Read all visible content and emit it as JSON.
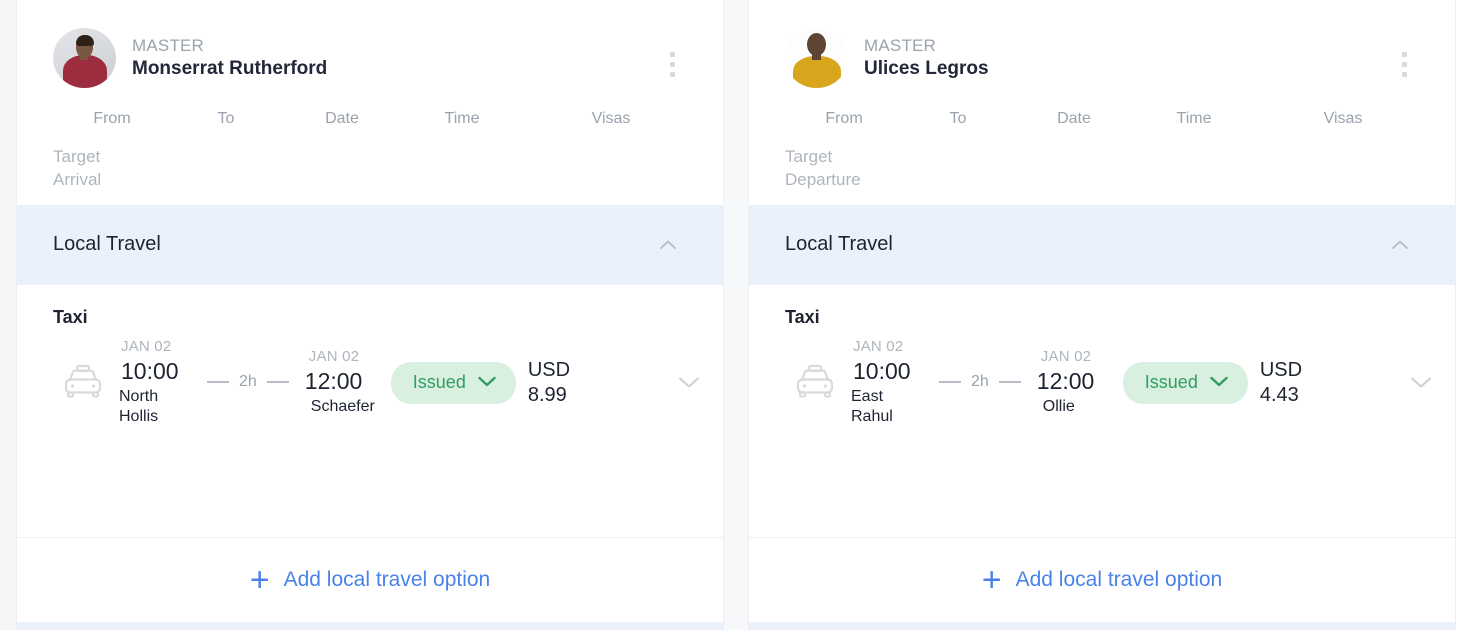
{
  "columns": [
    "From",
    "To",
    "Date",
    "Time",
    "Visas"
  ],
  "section": {
    "title": "Local Travel",
    "collapse_icon": "chevron-up-icon"
  },
  "footer": {
    "plus": "+",
    "label": "Add local travel option"
  },
  "colors": {
    "link": "#4a82e8",
    "badge_bg": "#d9f0e1",
    "badge_text": "#2f9e60",
    "section_bg": "#eaf1fb",
    "card_bg": "#ffffff",
    "page_bg": "#f4f5f7",
    "muted": "#9aa3ad",
    "text": "#1d2330"
  },
  "cards": [
    {
      "role": "MASTER",
      "name": "Monserrat Rutherford",
      "avatar": "person-photo-maroon-shirt",
      "menu_icon": "kebab-menu-icon",
      "target_label": "Target\nArrival",
      "target_line1": "Target",
      "target_line2": "Arrival",
      "segment": {
        "type": "Taxi",
        "icon": "taxi-icon",
        "departure": {
          "date": "JAN 02",
          "time": "10:00",
          "place_line1": "North",
          "place_line2": "Hollis"
        },
        "arrival": {
          "date": "JAN 02",
          "time": "12:00",
          "place_line1": "Schaefer",
          "place_line2": ""
        },
        "duration": "2h",
        "status": "Issued",
        "status_icon": "chevron-down-icon",
        "currency": "USD",
        "amount": "8.99",
        "expand_icon": "chevron-down-icon"
      }
    },
    {
      "role": "MASTER",
      "name": "Ulices Legros",
      "avatar": "person-photo-yellow-shirt",
      "menu_icon": "kebab-menu-icon",
      "target_label": "Target\nDeparture",
      "target_line1": "Target",
      "target_line2": "Departure",
      "segment": {
        "type": "Taxi",
        "icon": "taxi-icon",
        "departure": {
          "date": "JAN 02",
          "time": "10:00",
          "place_line1": "East",
          "place_line2": "Rahul"
        },
        "arrival": {
          "date": "JAN 02",
          "time": "12:00",
          "place_line1": "Ollie",
          "place_line2": ""
        },
        "duration": "2h",
        "status": "Issued",
        "status_icon": "chevron-down-icon",
        "currency": "USD",
        "amount": "4.43",
        "expand_icon": "chevron-down-icon"
      }
    }
  ]
}
